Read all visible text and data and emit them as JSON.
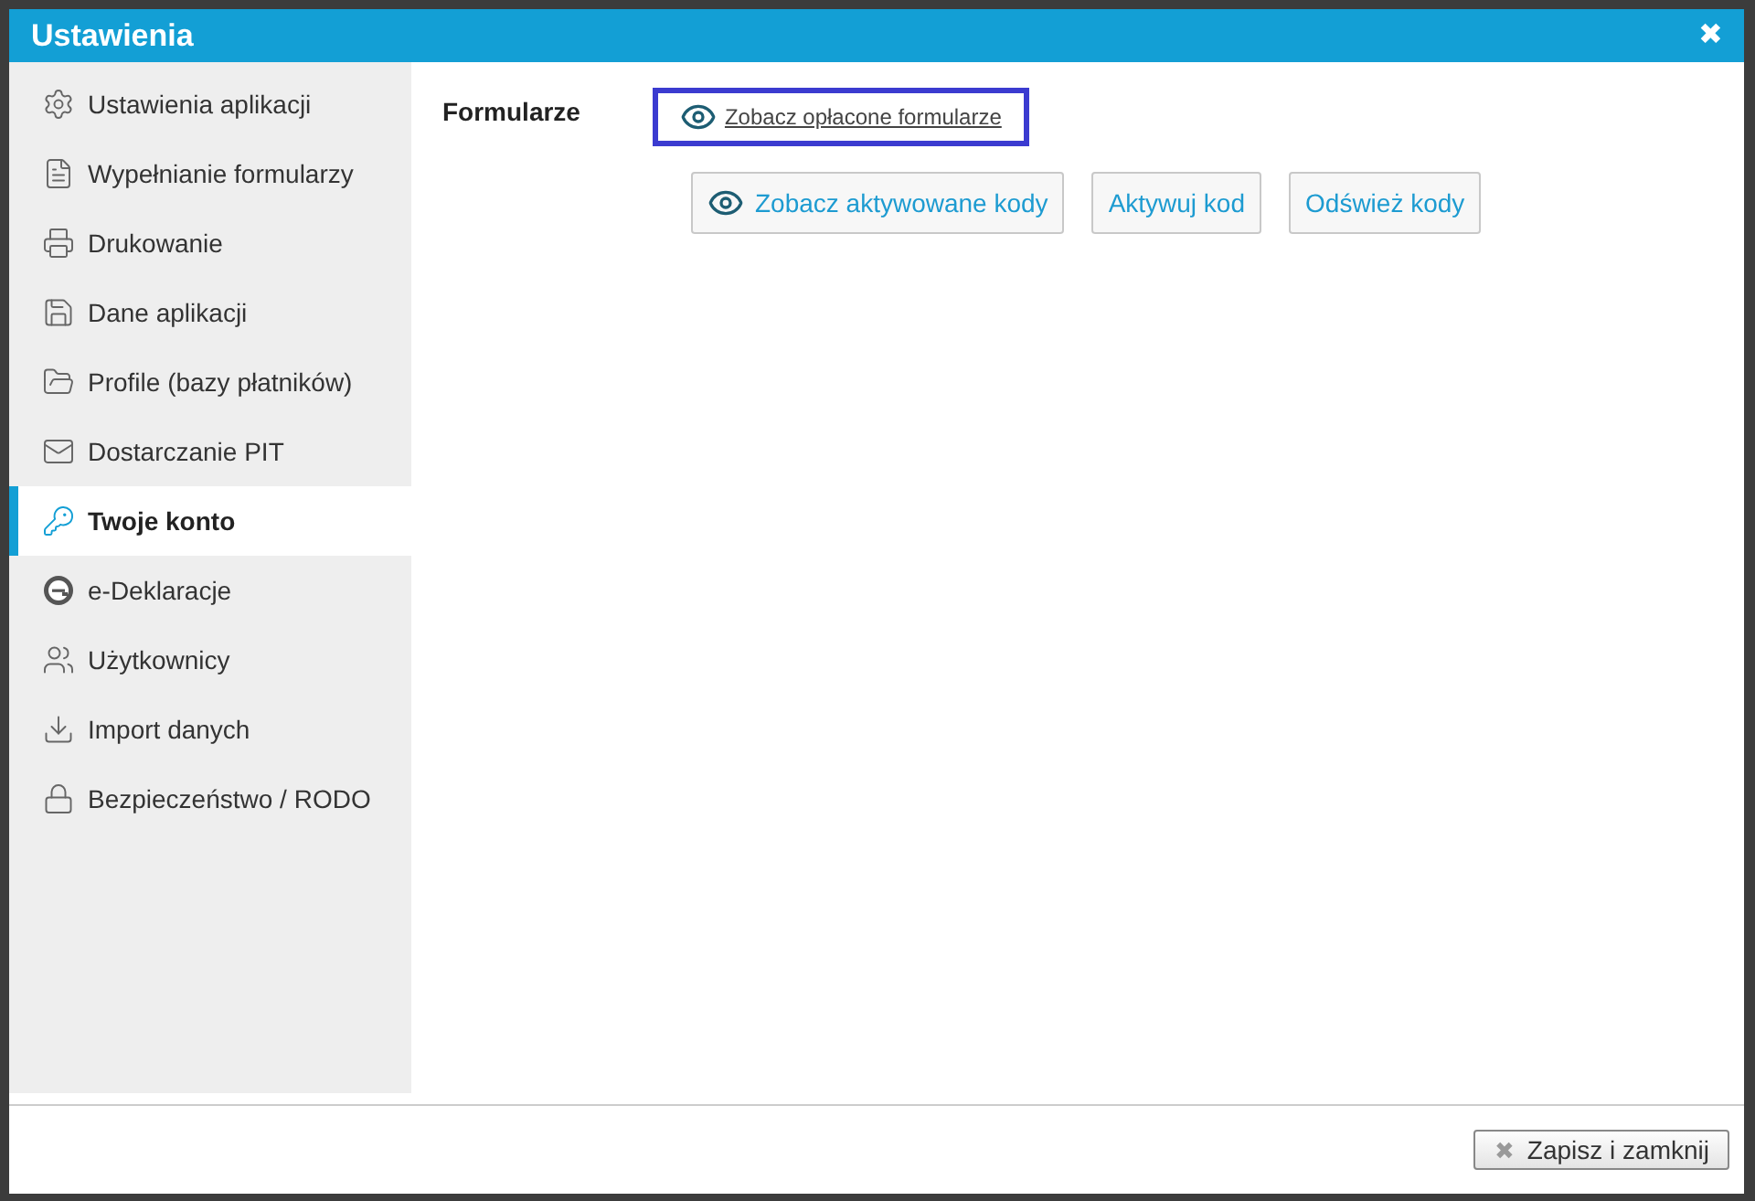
{
  "window": {
    "title": "Ustawienia",
    "close": "✖"
  },
  "sidebar": {
    "items": [
      {
        "label": "Ustawienia aplikacji",
        "selected": false
      },
      {
        "label": "Wypełnianie formularzy",
        "selected": false
      },
      {
        "label": "Drukowanie",
        "selected": false
      },
      {
        "label": "Dane aplikacji",
        "selected": false
      },
      {
        "label": "Profile (bazy płatników)",
        "selected": false
      },
      {
        "label": "Dostarczanie PIT",
        "selected": false
      },
      {
        "label": "Twoje konto",
        "selected": true
      },
      {
        "label": "e-Deklaracje",
        "selected": false
      },
      {
        "label": "Użytkownicy",
        "selected": false
      },
      {
        "label": "Import danych",
        "selected": false
      },
      {
        "label": "Bezpieczeństwo / RODO",
        "selected": false
      }
    ]
  },
  "section": {
    "label": "Formularze",
    "link": "Zobacz opłacone formularze",
    "buttons": [
      {
        "label": "Zobacz aktywowane kody",
        "kind": "eye"
      },
      {
        "label": "Aktywuj kod",
        "kind": "plain"
      },
      {
        "label": "Odśwież kody",
        "kind": "plain"
      }
    ]
  },
  "footer": {
    "button": "Zapisz i zamknij",
    "button_icon": "✖"
  }
}
